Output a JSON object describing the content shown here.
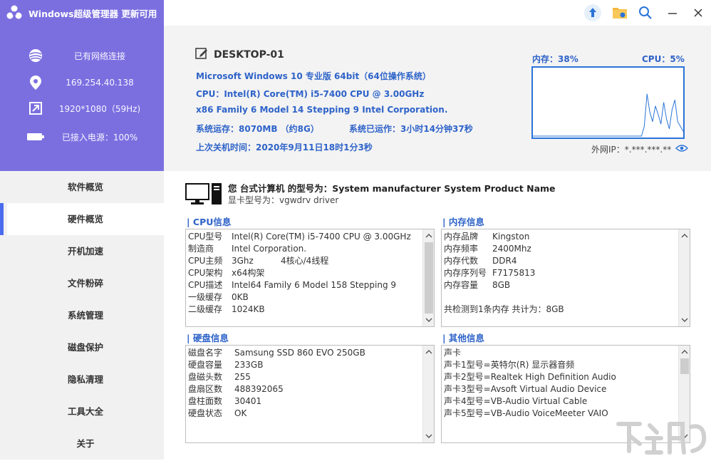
{
  "app": {
    "title": "Windows超级管理器 更新可用"
  },
  "sidebar_info": {
    "network": "已有网络连接",
    "ip": "169.254.40.138",
    "resolution": "1920*1080（59Hz)",
    "power": "已接入电源：100%"
  },
  "nav": [
    {
      "label": "软件概览",
      "active": false
    },
    {
      "label": "硬件概览",
      "active": true
    },
    {
      "label": "开机加速",
      "active": false
    },
    {
      "label": "文件粉碎",
      "active": false
    },
    {
      "label": "系统管理",
      "active": false
    },
    {
      "label": "磁盘保护",
      "active": false
    },
    {
      "label": "隐私清理",
      "active": false
    },
    {
      "label": "工具大全",
      "active": false
    },
    {
      "label": "关于",
      "active": false
    }
  ],
  "header": {
    "pc_name": "DESKTOP-01",
    "os": "Microsoft Windows 10 专业版 64bit（64位操作系统）",
    "cpu": "CPU：Intel(R) Core(TM) i5-7400 CPU @ 3.00GHz",
    "family": "x86 Family 6 Model 14 Stepping 9 Intel Corporation.",
    "ram": "系统运存：8070MB （约8G）",
    "uptime": "系统已运作：3小时14分钟37秒",
    "last_shutdown": "上次关机时间：2020年9月11日18时1分3秒",
    "mem_label": "内存：38%",
    "cpu_label": "CPU：5%",
    "external_ip": "外网IP：*.***.***.**",
    "mem_percent": 38,
    "cpu_percent": 5,
    "cpu_history": [
      0,
      0,
      0,
      0,
      0,
      0,
      0,
      0,
      0,
      0,
      0,
      0,
      0,
      0,
      0,
      0,
      0,
      0,
      0,
      0,
      0,
      0,
      0,
      0,
      0,
      0,
      0,
      0,
      0,
      0,
      0,
      0,
      0,
      0,
      0,
      0,
      0,
      0,
      0,
      0,
      8,
      35,
      20,
      12,
      25,
      18,
      10,
      28,
      14,
      6,
      22,
      30,
      12,
      8,
      4
    ]
  },
  "model": {
    "title": "您 台式计算机 的型号为：System manufacturer System Product Name",
    "gpu": "显卡型号为：vgwdrv driver"
  },
  "cpu_section": {
    "title": "CPU信息",
    "rows": [
      {
        "k": "CPU型号",
        "v": "Intel(R) Core(TM) i5-7400 CPU @ 3.00GHz",
        "extra": ""
      },
      {
        "k": "制造商",
        "v": "Intel Corporation.",
        "extra": ""
      },
      {
        "k": "CPU主频",
        "v": "3Ghz",
        "extra": "4核心/4线程"
      },
      {
        "k": "CPU架构",
        "v": "x64构架",
        "extra": ""
      },
      {
        "k": "CPU描述",
        "v": "Intel64 Family 6 Model 158 Stepping 9",
        "extra": ""
      },
      {
        "k": "一级缓存",
        "v": "0KB",
        "extra": ""
      },
      {
        "k": "二级缓存",
        "v": "1024KB",
        "extra": ""
      }
    ]
  },
  "mem_section": {
    "title": "内存信息",
    "rows": [
      {
        "k": "内存品牌",
        "v": "Kingston"
      },
      {
        "k": "内存频率",
        "v": "2400Mhz"
      },
      {
        "k": "内存代数",
        "v": "DDR4"
      },
      {
        "k": "内存序列号",
        "v": "F7175813"
      },
      {
        "k": "内存容量",
        "v": "8GB"
      }
    ],
    "summary": "共检测到1条内存 共计为：8GB"
  },
  "disk_section": {
    "title": "硬盘信息",
    "rows": [
      {
        "k": "磁盘名字",
        "v": "Samsung SSD 860 EVO 250GB"
      },
      {
        "k": "硬盘容量",
        "v": "233GB"
      },
      {
        "k": "盘磁头数",
        "v": "255"
      },
      {
        "k": "盘扇区数",
        "v": "488392065"
      },
      {
        "k": "盘柱面数",
        "v": "30401"
      },
      {
        "k": "硬盘状态",
        "v": "OK"
      }
    ]
  },
  "other_section": {
    "title": "其他信息",
    "rows": [
      "声卡",
      "声卡1型号=英特尔(R) 显示器音频",
      "声卡2型号=Realtek High Definition Audio",
      "声卡3型号=Avsoft Virtual Audio Device",
      "声卡4型号=VB-Audio Virtual Cable",
      "声卡5型号=VB-Audio VoiceMeeter VAIO"
    ]
  },
  "colors": {
    "brand": "#7b6fe0",
    "accent": "#2e63c9",
    "active_bar": "#4c6cf0"
  }
}
